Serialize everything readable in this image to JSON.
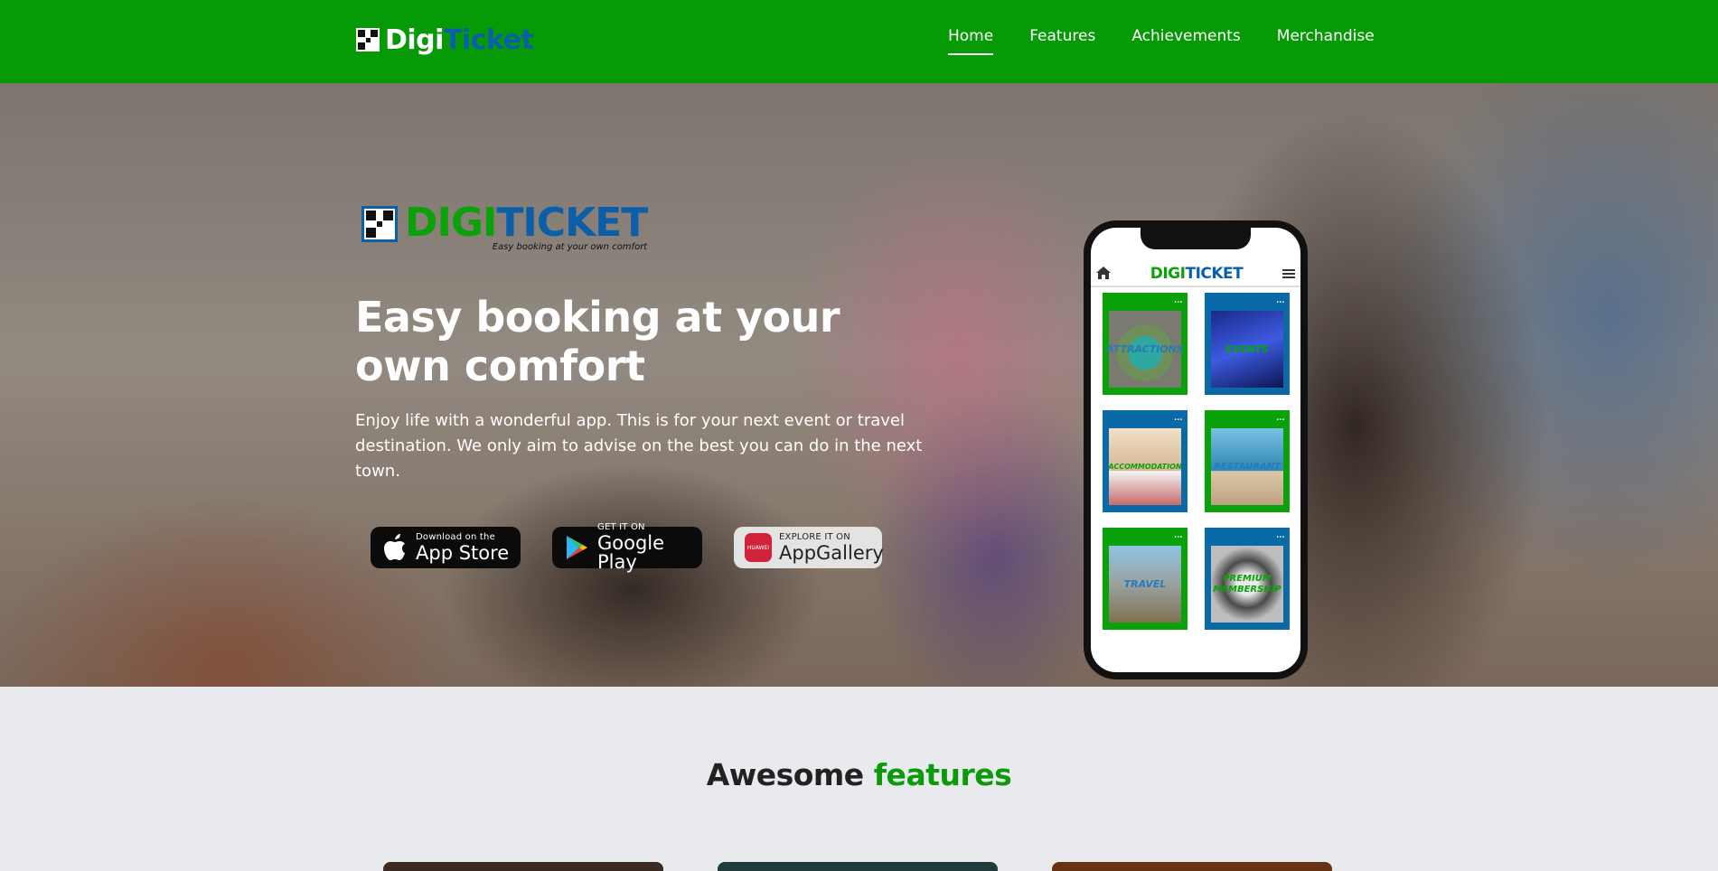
{
  "navbar": {
    "brand_part1": "Digi",
    "brand_part2": "Ticket",
    "links": [
      "Home",
      "Features",
      "Achievements",
      "Merchandise"
    ],
    "active_link": "Home",
    "background_color": "#079a07"
  },
  "hero": {
    "logo_part1": "DIGI",
    "logo_part2": "TICKET",
    "logo_tagline": "Easy booking at your own comfort",
    "title": "Easy booking at your own comfort",
    "description": "Enjoy life with a wonderful app. This is for your next event or travel destination. We only aim to advise on the best you can do in the next town.",
    "store_buttons": [
      {
        "small": "Download on the",
        "big": "App Store",
        "icon": "apple-icon"
      },
      {
        "small": "GET IT ON",
        "big": "Google Play",
        "icon": "google-play-icon"
      },
      {
        "small": "EXPLORE IT ON",
        "big": "AppGallery",
        "icon": "huawei-icon",
        "icon_text": "HUAWEI"
      }
    ]
  },
  "phone": {
    "app_title_part1": "DIGI",
    "app_title_part2": "TICKET",
    "tiles": [
      {
        "label": "ATTRACTIONS",
        "color": "#0aa10a",
        "label_color": "#2a7ab8"
      },
      {
        "label": "EVENTS",
        "color": "#0a6aa8",
        "label_color": "#0aa10a"
      },
      {
        "label": "ACCOMMODATION",
        "color": "#0a6aa8",
        "label_color": "#0aa10a"
      },
      {
        "label": "RESTAURANT",
        "color": "#0aa10a",
        "label_color": "#2a7ab8"
      },
      {
        "label": "TRAVEL",
        "color": "#0aa10a",
        "label_color": "#2a7ab8"
      },
      {
        "label": "PREMIUM MEMBERSHIP",
        "color": "#0a6aa8",
        "label_color": "#0aa10a"
      }
    ],
    "tile_menu": "..."
  },
  "features": {
    "title_part1": "Awesome",
    "title_part2": "features",
    "accent_color": "#0a9a0a"
  }
}
